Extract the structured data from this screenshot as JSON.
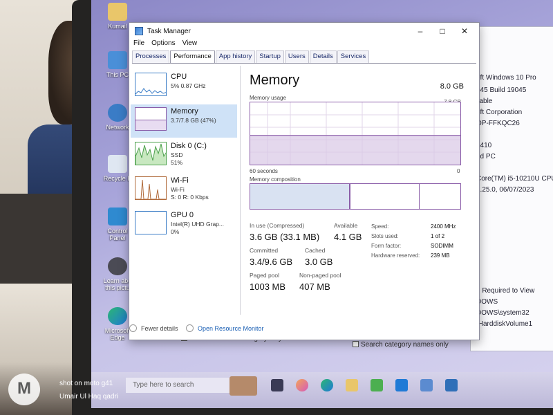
{
  "window": {
    "title": "Task Manager",
    "controls": [
      "–",
      "□",
      "✕"
    ]
  },
  "menu": [
    "File",
    "Options",
    "View"
  ],
  "tabs": [
    "Processes",
    "Performance",
    "App history",
    "Startup",
    "Users",
    "Details",
    "Services"
  ],
  "active_tab": "Performance",
  "resources": [
    {
      "name": "CPU",
      "line1": "5% 0.87 GHz",
      "line2": ""
    },
    {
      "name": "Memory",
      "line1": "3.7/7.8 GB (47%)",
      "line2": ""
    },
    {
      "name": "Disk 0 (C:)",
      "line1": "SSD",
      "line2": "51%"
    },
    {
      "name": "Wi-Fi",
      "line1": "Wi-Fi",
      "line2": "S: 0 R: 0 Kbps"
    },
    {
      "name": "GPU 0",
      "line1": "Intel(R) UHD Grap...",
      "line2": "0%"
    }
  ],
  "memory": {
    "heading": "Memory",
    "total": "8.0 GB",
    "usage_label": "Memory usage",
    "usage_max": "7.8 GB",
    "time_left": "60 seconds",
    "time_right": "0",
    "composition_label": "Memory composition",
    "usage_fraction": 0.47,
    "stats": {
      "in_use_label": "In use (Compressed)",
      "in_use_value": "3.6 GB (33.1 MB)",
      "available_label": "Available",
      "available_value": "4.1 GB",
      "committed_label": "Committed",
      "committed_value": "3.4/9.6 GB",
      "cached_label": "Cached",
      "cached_value": "3.0 GB",
      "paged_label": "Paged pool",
      "paged_value": "1003 MB",
      "nonpaged_label": "Non-paged pool",
      "nonpaged_value": "407 MB"
    },
    "details": [
      {
        "k": "Speed:",
        "v": "2400 MHz"
      },
      {
        "k": "Slots used:",
        "v": "1 of 2"
      },
      {
        "k": "Form factor:",
        "v": "SODIMM"
      },
      {
        "k": "Hardware reserved:",
        "v": "239 MB"
      }
    ]
  },
  "footer": {
    "fewer_details": "Fewer details",
    "open_monitor": "Open Resource Monitor"
  },
  "desktop_icons": [
    "Kumail",
    "This PC",
    "Network",
    "Recycle B",
    "Control Panel",
    "Learn abo this pictu",
    "Microsoft Edge"
  ],
  "bg_window_rows": [
    "oft Windows 10 Pro",
    "045 Build 19045",
    "ilable",
    "oft Corporation",
    "OP-FFKQC26",
    "3410",
    "ed PC",
    "Core(TM) i5-10210U CPU",
    "1.25.0, 06/07/2023",
    "n Required to View",
    "DOWS",
    "DOWS\\system32",
    "\\HarddiskVolume1"
  ],
  "bg_search": {
    "selected_only": "Search selected category only",
    "names_only": "Search category names only"
  },
  "taskbar": {
    "search_placeholder": "Type here to search"
  },
  "watermark": {
    "line1": "shot on moto g41",
    "line2": "Umair Ul Haq qadri"
  }
}
